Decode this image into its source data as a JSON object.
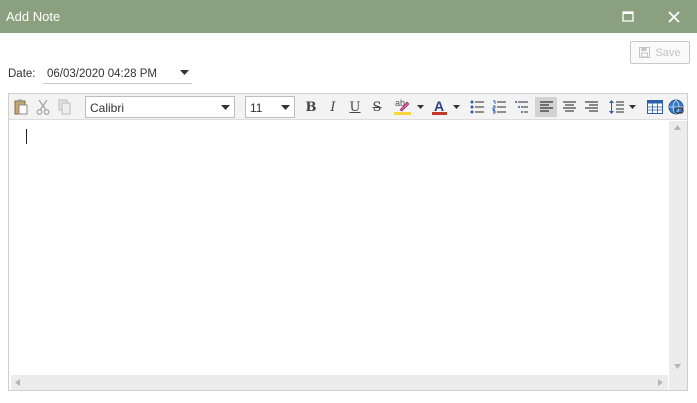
{
  "window": {
    "title": "Add Note",
    "maximize_icon": "maximize-icon",
    "close_icon": "close-icon"
  },
  "save": {
    "label": "Save",
    "icon": "save-disk-icon",
    "enabled": false
  },
  "date": {
    "label": "Date:",
    "value": "06/03/2020 04:28 PM",
    "dropdown_icon": "chevron-down-icon"
  },
  "toolbar": {
    "font_family": "Calibri",
    "font_size": "11",
    "bold_glyph": "B",
    "italic_glyph": "I",
    "underline_glyph": "U",
    "strike_glyph": "S",
    "font_color_glyph": "A",
    "highlight_glyph": "ab",
    "alignment": "left"
  },
  "colors": {
    "titlebar": "#8aa07e",
    "highlight_swatch": "#f5d73b",
    "font_color_swatch": "#c0392b",
    "active_button": "#d3d3d3"
  },
  "editor": {
    "content": ""
  }
}
